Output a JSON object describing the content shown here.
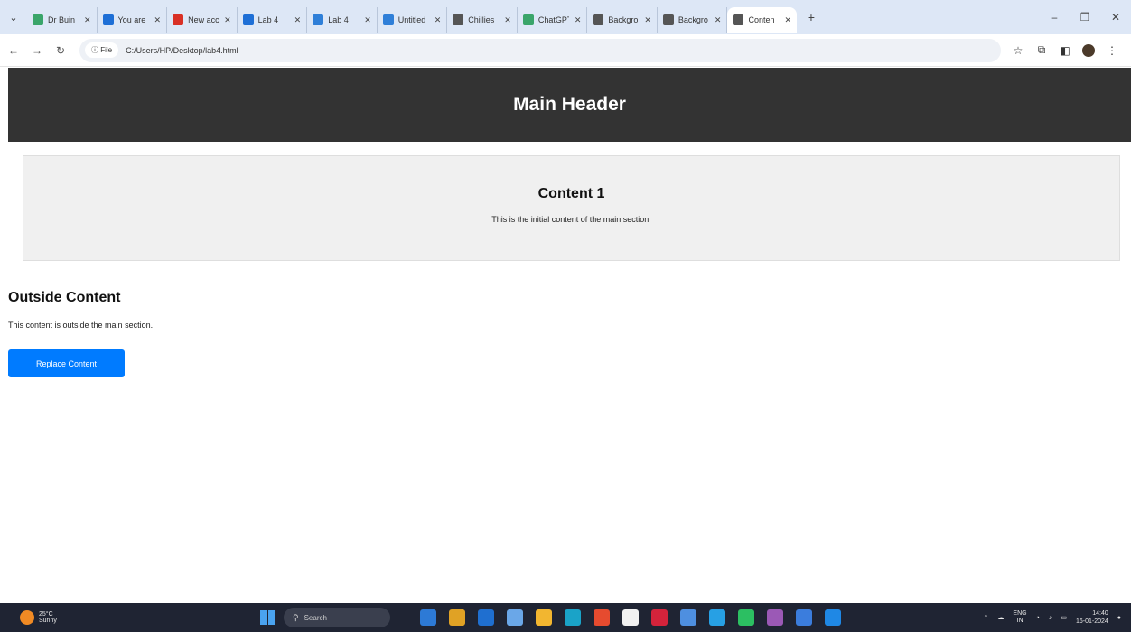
{
  "browser": {
    "tabs": [
      {
        "title": "Dr Buin",
        "color": "#3aa56a"
      },
      {
        "title": "You are",
        "color": "#1e6fd6"
      },
      {
        "title": "New acc",
        "color": "#d93025"
      },
      {
        "title": "Lab 4",
        "color": "#1e6fd6"
      },
      {
        "title": "Lab 4",
        "color": "#2f7fd8"
      },
      {
        "title": "Untitled",
        "color": "#2f7fd8"
      },
      {
        "title": "Chillies",
        "color": "#555555"
      },
      {
        "title": "ChatGPT",
        "color": "#3aa56a"
      },
      {
        "title": "Backgro",
        "color": "#555555"
      },
      {
        "title": "Backgro",
        "color": "#555555"
      },
      {
        "title": "Conten",
        "color": "#555555",
        "active": true
      }
    ],
    "address": {
      "chip": "File",
      "url": "C:/Users/HP/Desktop/lab4.html"
    }
  },
  "page": {
    "header_title": "Main Header",
    "content_title": "Content 1",
    "content_text": "This is the initial content of the main section.",
    "outside_title": "Outside Content",
    "outside_text": "This content is outside the main section.",
    "button_label": "Replace Content"
  },
  "taskbar": {
    "weather_temp": "25°C",
    "weather_desc": "Sunny",
    "search_placeholder": "Search",
    "tray_lang": "ENG",
    "tray_region": "IN",
    "time": "14:40",
    "date": "16-01-2024",
    "apps": [
      "#2d7ad6",
      "#e0a225",
      "#1f6fd0",
      "#6aa7e8",
      "#f2b630",
      "#1aa3c8",
      "#e64b2f",
      "#f1f1f1",
      "#d4233b",
      "#4e8fe0",
      "#27a0e4",
      "#2cbf62",
      "#9b59b6",
      "#3b7ddd",
      "#1f88e5"
    ]
  }
}
